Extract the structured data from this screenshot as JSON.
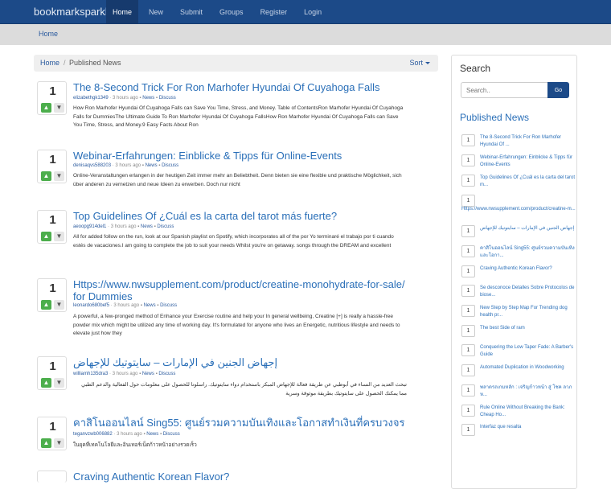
{
  "navbar": {
    "brand": "bookmarksparkle",
    "items": [
      "Home",
      "New",
      "Submit",
      "Groups",
      "Register",
      "Login"
    ]
  },
  "subnav": {
    "home": "Home"
  },
  "breadcrumb": {
    "home": "Home",
    "separator": "/",
    "current": "Published News",
    "sort": "Sort"
  },
  "posts": [
    {
      "votes": "1",
      "title": "The 8-Second Trick For Ron Marhofer Hyundai Of Cuyahoga Falls",
      "user": "elizabethgk1349",
      "time": "3 hours ago",
      "cat1": "News",
      "cat2": "Discuss",
      "excerpt": "How Ron Marhofer Hyundai Of Cuyahoga Falls can Save You Time, Stress, and Money. Table of ContentsRon Marhofer Hyundai Of Cuyahoga Falls for DummiesThe Ultimate Guide To Ron Marhofer Hyundai Of Cuyahoga FallsHow Ron Marhofer Hyundai Of Cuyahoga Falls can Save You Time, Stress, and Money.9 Easy Facts About Ron"
    },
    {
      "votes": "1",
      "title": "Webinar-Erfahrungen: Einblicke & Tipps für Online-Events",
      "user": "denisaqvs588203",
      "time": "3 hours ago",
      "cat1": "News",
      "cat2": "Discuss",
      "excerpt": "Online-Veranstaltungen erlangen in der heutigen Zeit immer mehr an Beliebtheit. Denn bieten sie eine flexible und praktische Möglichkeit, sich über anderen zu vernetzen und neue Ideen zu erwerben. Doch nur nicht"
    },
    {
      "votes": "1",
      "title": "Top Guidelines Of ¿Cuál es la carta del tarot más fuerte?",
      "user": "aeoopg914del1",
      "time": "3 hours ago",
      "cat1": "News",
      "cat2": "Discuss",
      "excerpt": "All for added follow on the run, look at our Spanish playlist on Spotify, which incorporates all of the por Yo terminaré el trabajo por ti cuando estés de vacaciones.I am going to complete the job to suit your needs Whilst you're on getaway. songs through the DREAM and excellent"
    },
    {
      "votes": "1",
      "title": "Https://www.nwsupplement.com/product/creatine-monohydrate-for-sale/ for Dummies",
      "user": "leonardo680bef5",
      "time": "3 hours ago",
      "cat1": "News",
      "cat2": "Discuss",
      "excerpt": "A powerful, a few-pronged method of Enhance your Exercise routine and help your In general wellbeing, Creatine [+] is really a hassle-free powder mix which might be utilized any time of working day. It's formulated for anyone who lives an Energetic, nutritious lifestyle and needs to elevate just how they"
    },
    {
      "votes": "1",
      "title": "إجهاض الجنين في الإمارات – سايتوتيك للإجهاض",
      "user": "williamh135dra3",
      "time": "3 hours ago",
      "cat1": "News",
      "cat2": "Discuss",
      "excerpt": "تبحث العديد من النساء في أبوظبي عن طريقة فعالة للإجهاض المبكر باستخدام دواء سايتوتيك. راسلونا للحصول على معلومات حول الفعالية والدعم الطبي مما يمكنك الحصول على سايتوتيك بطريقة موثوقة وسرية"
    },
    {
      "votes": "1",
      "title": "คาสิโนออนไลน์ Sing55: ศูนย์รวมความบันเทิงและโอกาสทำเงินที่ครบวงจร",
      "user": "teganvzwb006882",
      "time": "3 hours ago",
      "cat1": "News",
      "cat2": "Discuss",
      "excerpt": "ในยุคที่เทคโนโลยีและอินเทอร์เน็ตก้าวหน้าอย่างรวดเร็ว"
    },
    {
      "votes": "1",
      "title": "Craving Authentic Korean Flavor?",
      "user": "",
      "time": "",
      "cat1": "",
      "cat2": "",
      "excerpt": ""
    }
  ],
  "sidebar": {
    "search_title": "Search",
    "search_placeholder": "Search..",
    "search_button": "Go",
    "news_title": "Published News",
    "items": [
      {
        "count": "1",
        "title": "The 8-Second Trick For Ron Marhofer Hyundai Of ..."
      },
      {
        "count": "1",
        "title": "Webinar-Erfahrungen: Einblicke & Tipps für Online-Events"
      },
      {
        "count": "1",
        "title": "Top Guidelines Of ¿Cuál es la carta del tarot m..."
      },
      {
        "count": "1",
        "title": "Https://www.nwsupplement.com/product/creatine-m..."
      },
      {
        "count": "1",
        "title": "إجهاض الجنين في الإمارات – سايتوتيك للإجهاض"
      },
      {
        "count": "1",
        "title": "คาสิโนออนไลน์ Sing55: ศูนย์รวมความบันเทิงและโอกา..."
      },
      {
        "count": "1",
        "title": "Craving Authentic Korean Flavor?"
      },
      {
        "count": "1",
        "title": "Se desconoce Detalles Sobre Protocolos de biose..."
      },
      {
        "count": "1",
        "title": "New Step by Step Map For Trending dog health pr..."
      },
      {
        "count": "1",
        "title": "The best Side of ram"
      },
      {
        "count": "1",
        "title": "Conquering the Low Taper Fade: A Barber's Guide"
      },
      {
        "count": "1",
        "title": "Automated Duplication in Woodworking"
      },
      {
        "count": "1",
        "title": "พลาดรถเกมหลัก : เจริญก้าวหน้า สู่ โชค ลาภ ห..."
      },
      {
        "count": "1",
        "title": "Rule Online Without Breaking the Bank: Cheap Ho..."
      },
      {
        "count": "1",
        "title": "Interfaz que resalta"
      }
    ]
  },
  "colors": {
    "navbar": "#1c4a88",
    "link": "#2a6fb8",
    "upvote": "#4cae4c"
  }
}
